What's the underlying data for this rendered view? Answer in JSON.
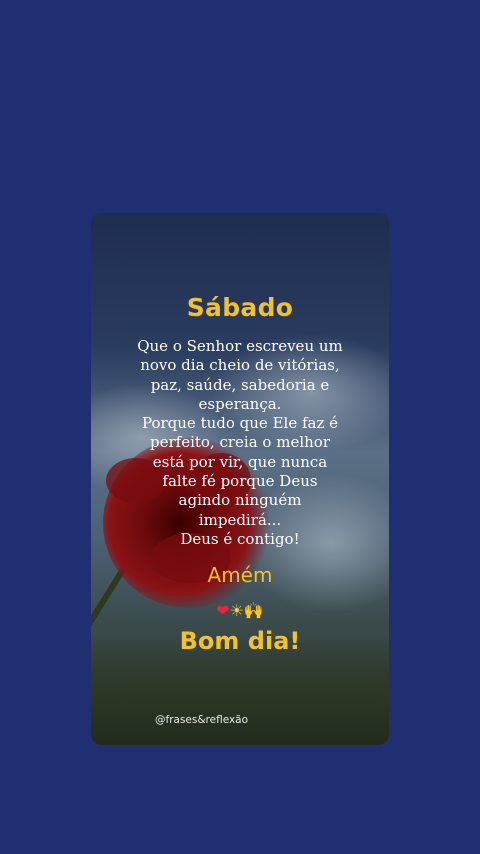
{
  "card": {
    "title": "Sábado",
    "message_lines": [
      "Que o Senhor escreveu um",
      "novo dia cheio de vitórias,",
      "paz, saúde, sabedoria e",
      "esperança.",
      "Porque tudo que Ele faz é",
      "perfeito, creia o melhor",
      "está por vir, que nunca",
      "falte fé porque Deus",
      "agindo ninguém",
      "impedirá...",
      "Deus é contigo!"
    ],
    "amen": "Amém",
    "emojis": {
      "heart": "❤",
      "sun": "☀",
      "hands": "🙌"
    },
    "greeting": "Bom dia!",
    "handle": "@frases&reflexão"
  },
  "colors": {
    "background": "#1f2f72",
    "accent": "#f2c12e",
    "text": "#ffffff"
  }
}
